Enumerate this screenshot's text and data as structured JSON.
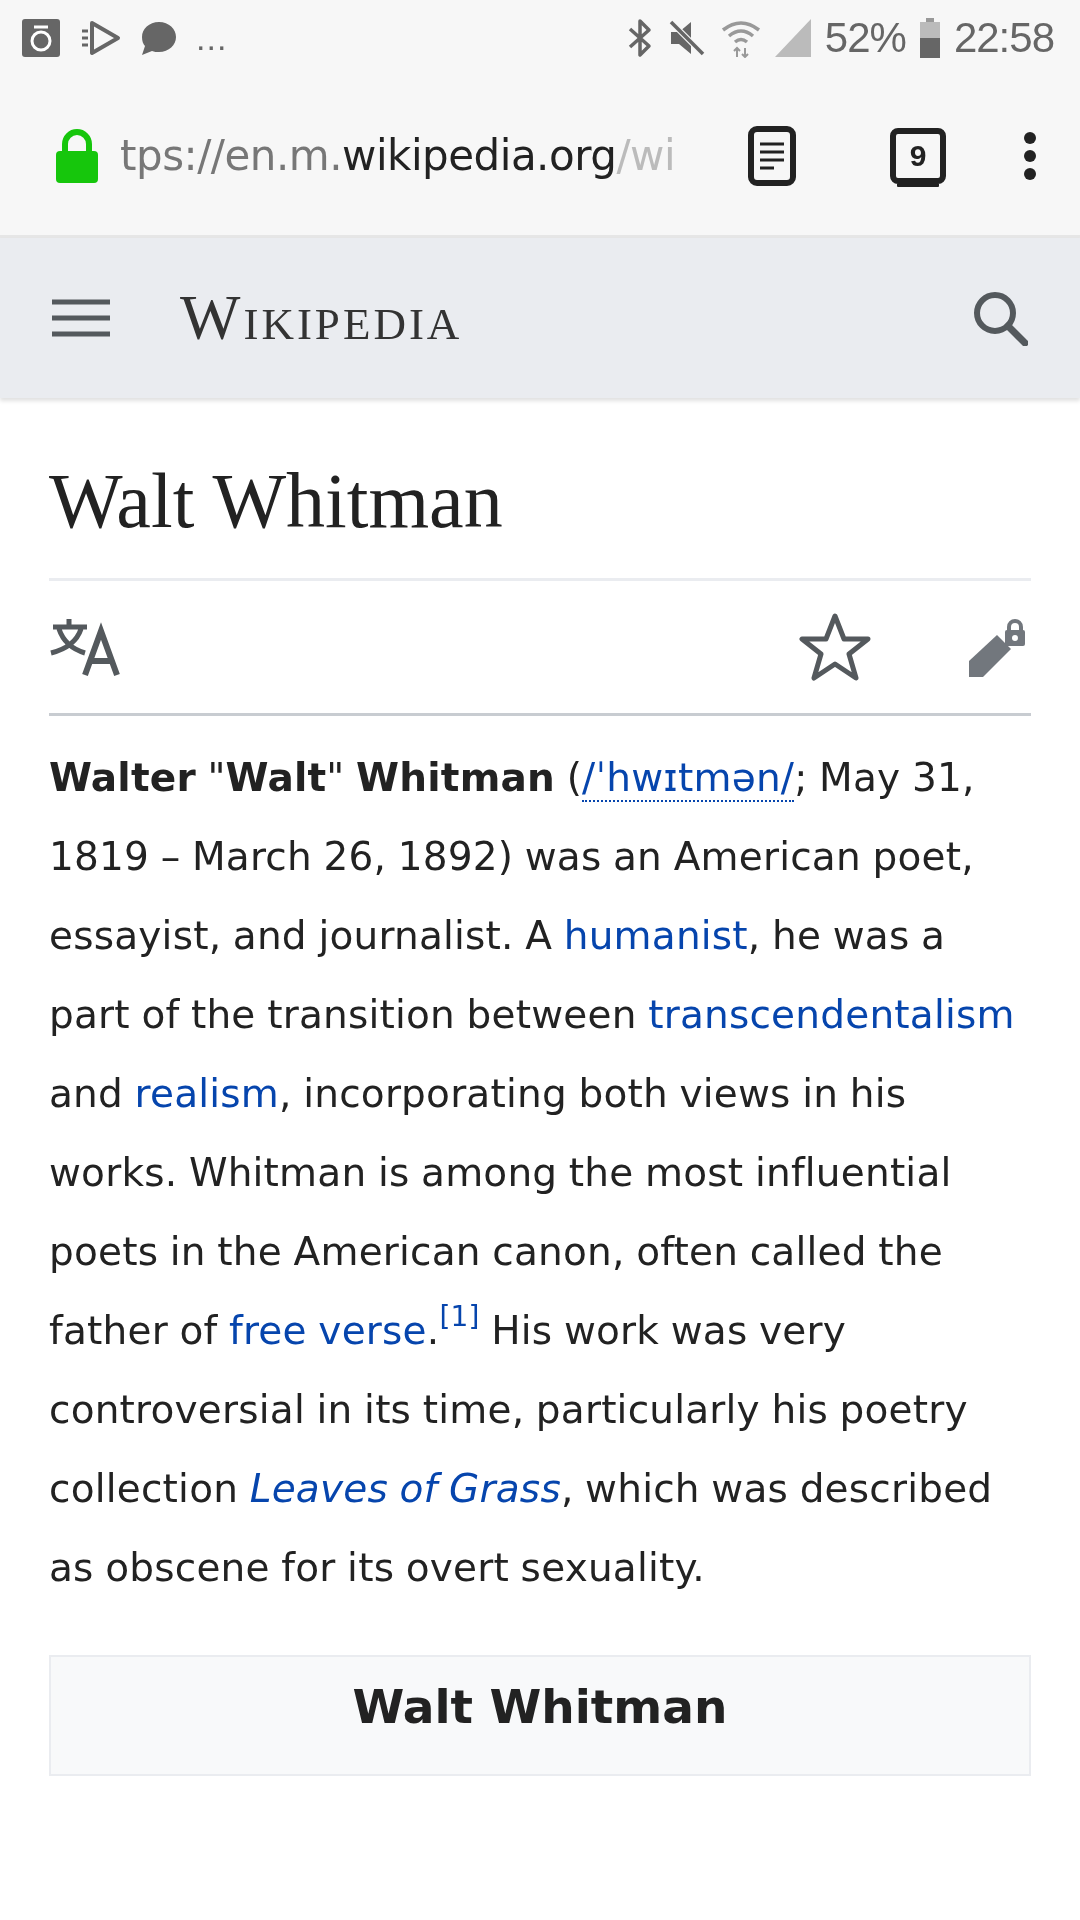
{
  "status_bar": {
    "overflow": "...",
    "battery": "52%",
    "time": "22:58"
  },
  "address_bar": {
    "url_parts": [
      {
        "text": "tps://en.m.",
        "kind": "faded"
      },
      {
        "text": "wikipedia.org",
        "kind": "host"
      },
      {
        "text": "/wi",
        "kind": "fade-out"
      }
    ],
    "tab_count": "9"
  },
  "header": {
    "logo": "Wikipedia"
  },
  "article": {
    "title": "Walt Whitman",
    "lead": [
      {
        "kind": "text",
        "text": "**Walter** \"**Walt**\" **Whitman** ("
      },
      {
        "kind": "ipa",
        "text": "/ˈhwɪtmən/"
      },
      {
        "kind": "text",
        "text": "; May 31, 1819 – March 26, 1892) was an American poet, essayist, and journalist. A "
      },
      {
        "kind": "link",
        "text": "humanist"
      },
      {
        "kind": "text",
        "text": ", he was a part of the transition between "
      },
      {
        "kind": "link",
        "text": "transcendentalism"
      },
      {
        "kind": "text",
        "text": " and "
      },
      {
        "kind": "link",
        "text": "realism"
      },
      {
        "kind": "text",
        "text": ", incorporating both views in his works. Whitman is among the most influential poets in the American canon, often called the father of "
      },
      {
        "kind": "link",
        "text": "free verse"
      },
      {
        "kind": "text",
        "text": "."
      },
      {
        "kind": "ref",
        "text": "[1]"
      },
      {
        "kind": "text",
        "text": " His work was very controversial in its time, particularly his poetry collection "
      },
      {
        "kind": "link",
        "text": "*Leaves of Grass*"
      },
      {
        "kind": "text",
        "text": ", which was described as obscene for its overt sexuality."
      }
    ],
    "infobox": {
      "title": "Walt Whitman"
    }
  }
}
